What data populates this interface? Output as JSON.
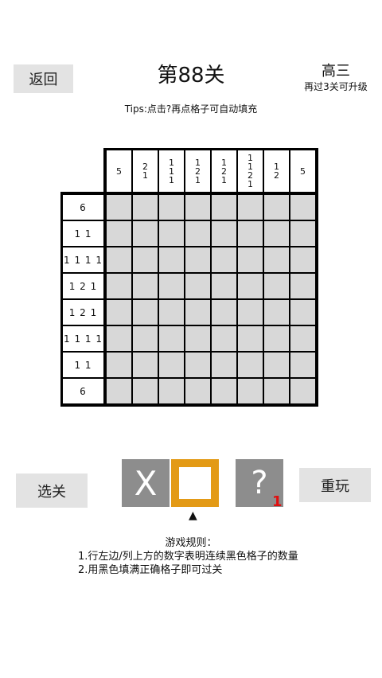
{
  "header": {
    "back_label": "返回",
    "level_title": "第88关",
    "grade": "高三",
    "upgrade_text": "再过3关可升级"
  },
  "tips": "Tips:点击?再点格子可自动填充",
  "puzzle": {
    "size": 8,
    "column_hints": [
      [
        "5"
      ],
      [
        "2",
        "1"
      ],
      [
        "1",
        "1",
        "1"
      ],
      [
        "1",
        "2",
        "1"
      ],
      [
        "1",
        "2",
        "1"
      ],
      [
        "1",
        "1",
        "2",
        "1"
      ],
      [
        "1",
        "2"
      ],
      [
        "5"
      ]
    ],
    "row_hints": [
      "6",
      "1 1",
      "1 1 1 1",
      "1 2 1",
      "1 2 1",
      "1 1 1 1",
      "1 1",
      "6"
    ]
  },
  "tools": {
    "cross_label": "X",
    "hint_label": "?",
    "hint_count": "1",
    "selected": "fill",
    "pointer": "▲",
    "cross_color": "#8d8d8d",
    "selected_color": "#e39a16",
    "hint_count_color": "#e01010"
  },
  "buttons": {
    "select_label": "选关",
    "replay_label": "重玩"
  },
  "rules": {
    "title": "游戏规则：",
    "items": [
      "1.行左边/列上方的数字表明连续黑色格子的数量",
      "2.用黑色填满正确格子即可过关"
    ]
  }
}
